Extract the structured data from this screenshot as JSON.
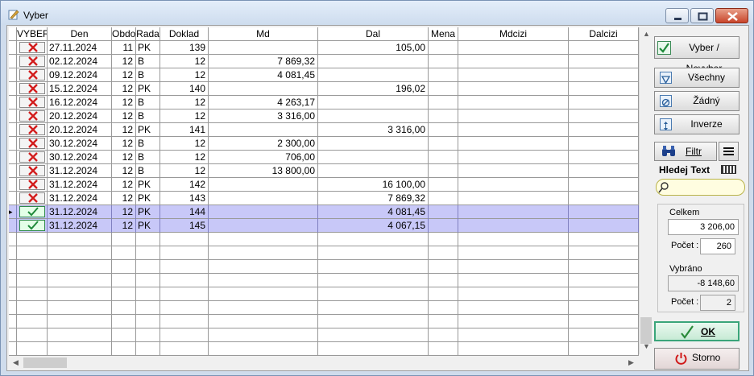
{
  "window": {
    "title": "Vyber"
  },
  "grid": {
    "headers": [
      "VYBER",
      "Den",
      "Obdo",
      "Rada",
      "Doklad",
      "Md",
      "Dal",
      "Mena",
      "Mdcizi",
      "Dalcizi"
    ],
    "rows": [
      {
        "checked": false,
        "den": "27.11.2024",
        "obdo": "11",
        "rada": "PK",
        "doklad": "139",
        "md": "",
        "dal": "105,00"
      },
      {
        "checked": false,
        "den": "02.12.2024",
        "obdo": "12",
        "rada": "B",
        "doklad": "12",
        "md": "7 869,32",
        "dal": ""
      },
      {
        "checked": false,
        "den": "09.12.2024",
        "obdo": "12",
        "rada": "B",
        "doklad": "12",
        "md": "4 081,45",
        "dal": ""
      },
      {
        "checked": false,
        "den": "15.12.2024",
        "obdo": "12",
        "rada": "PK",
        "doklad": "140",
        "md": "",
        "dal": "196,02"
      },
      {
        "checked": false,
        "den": "16.12.2024",
        "obdo": "12",
        "rada": "B",
        "doklad": "12",
        "md": "4 263,17",
        "dal": ""
      },
      {
        "checked": false,
        "den": "20.12.2024",
        "obdo": "12",
        "rada": "B",
        "doklad": "12",
        "md": "3 316,00",
        "dal": ""
      },
      {
        "checked": false,
        "den": "20.12.2024",
        "obdo": "12",
        "rada": "PK",
        "doklad": "141",
        "md": "",
        "dal": "3 316,00"
      },
      {
        "checked": false,
        "den": "30.12.2024",
        "obdo": "12",
        "rada": "B",
        "doklad": "12",
        "md": "2 300,00",
        "dal": ""
      },
      {
        "checked": false,
        "den": "30.12.2024",
        "obdo": "12",
        "rada": "B",
        "doklad": "12",
        "md": "706,00",
        "dal": ""
      },
      {
        "checked": false,
        "den": "31.12.2024",
        "obdo": "12",
        "rada": "B",
        "doklad": "12",
        "md": "13 800,00",
        "dal": ""
      },
      {
        "checked": false,
        "den": "31.12.2024",
        "obdo": "12",
        "rada": "PK",
        "doklad": "142",
        "md": "",
        "dal": "16 100,00"
      },
      {
        "checked": false,
        "den": "31.12.2024",
        "obdo": "12",
        "rada": "PK",
        "doklad": "143",
        "md": "",
        "dal": "7 869,32"
      },
      {
        "checked": true,
        "den": "31.12.2024",
        "obdo": "12",
        "rada": "PK",
        "doklad": "144",
        "md": "",
        "dal": "4 081,45"
      },
      {
        "checked": true,
        "den": "31.12.2024",
        "obdo": "12",
        "rada": "PK",
        "doklad": "145",
        "md": "",
        "dal": "4 067,15"
      }
    ]
  },
  "side": {
    "vyber_label": "Vyber / Nevyber",
    "vsechny_label": "Všechny",
    "zadny_label": "Žádný",
    "inverze_label": "Inverze",
    "filtr_label": "Filtr",
    "hledej_label": "Hledej Text",
    "search_value": "",
    "celkem_label": "Celkem",
    "celkem_value": "3 206,00",
    "pocet_label": "Počet :",
    "pocet_value": "260",
    "vybrano_label": "Vybráno",
    "vybrano_value": "-8 148,60",
    "pocet2_label": "Počet :",
    "pocet2_value": "2",
    "ok_label": "OK",
    "storno_label": "Storno"
  },
  "colors": {
    "selected_row": "#c8c8f8",
    "check_red": "#d21c1c",
    "check_green": "#1f8a3a"
  }
}
